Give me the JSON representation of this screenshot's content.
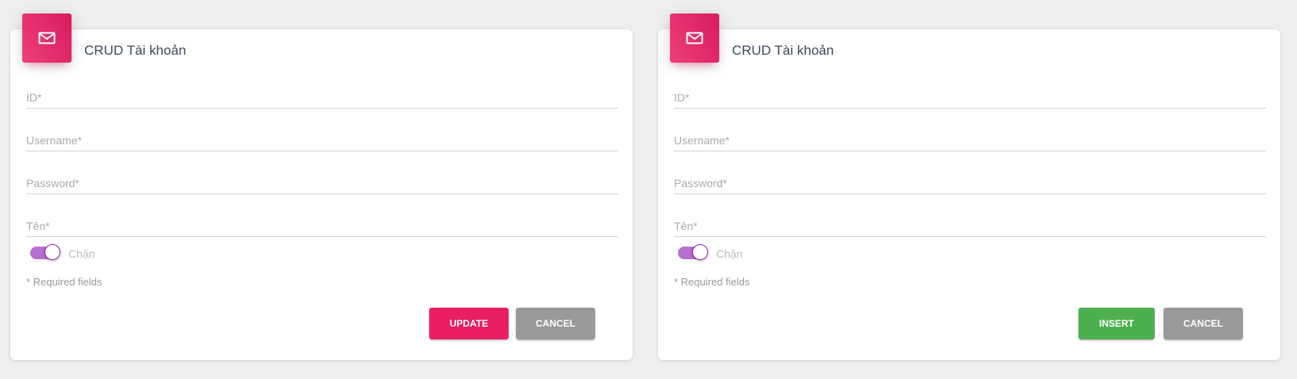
{
  "colors": {
    "background": "#eeeeee",
    "card_icon_gradient": [
      "#ec407a",
      "#d81b60"
    ],
    "toggle": "#9c27b0",
    "update_button": "#e91e63",
    "insert_button": "#4caf50",
    "cancel_button": "#999999"
  },
  "cards": [
    {
      "icon": "mail-icon",
      "title": "CRUD Tài khoản",
      "fields": {
        "id_placeholder": "ID*",
        "username_placeholder": "Username*",
        "password_placeholder": "Password*",
        "name_placeholder": "Tên*"
      },
      "toggle": {
        "label": "Chặn",
        "on": true
      },
      "required_note": "* Required fields",
      "primary_button": "UPDATE",
      "cancel_button": "CANCEL",
      "separator": "."
    },
    {
      "icon": "mail-icon",
      "title": "CRUD Tài khoản",
      "fields": {
        "id_placeholder": "ID*",
        "username_placeholder": "Username*",
        "password_placeholder": "Password*",
        "name_placeholder": "Tên*"
      },
      "toggle": {
        "label": "Chặn",
        "on": true
      },
      "required_note": "* Required fields",
      "primary_button": "INSERT",
      "cancel_button": "CANCEL",
      "separator": "."
    }
  ]
}
